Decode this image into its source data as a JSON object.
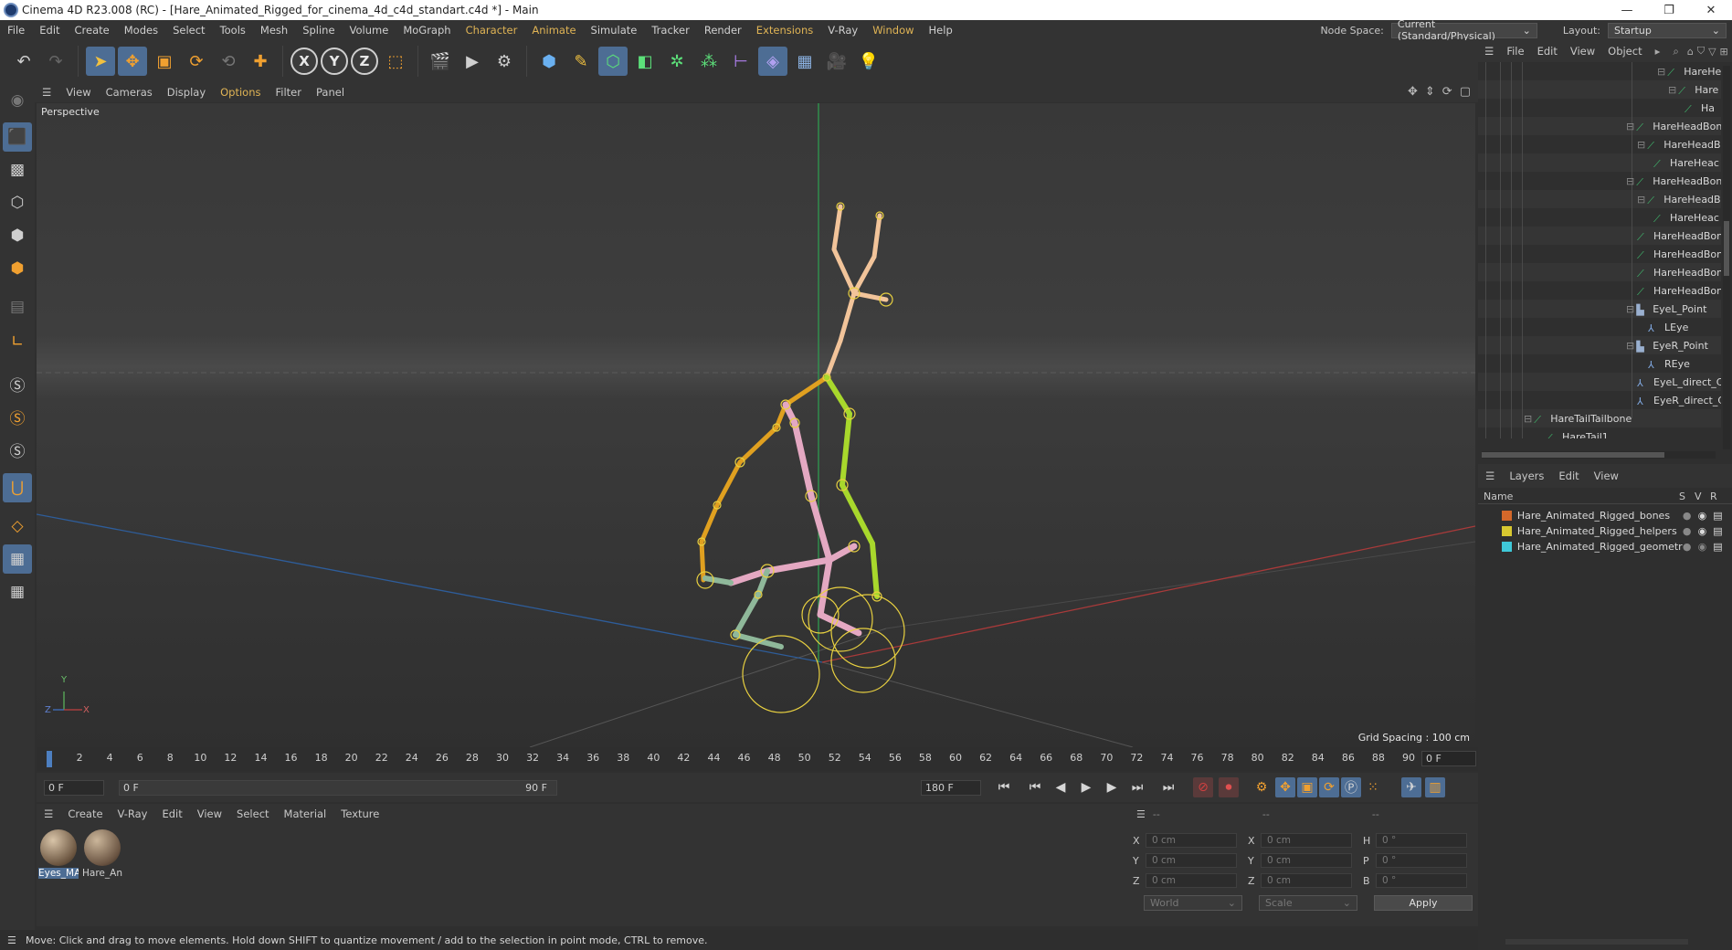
{
  "window": {
    "title": "Cinema 4D R23.008 (RC) - [Hare_Animated_Rigged_for_cinema_4d_c4d_standart.c4d *] - Main",
    "controls": [
      "—",
      "❐",
      "✕"
    ]
  },
  "menubar": {
    "items": [
      "File",
      "Edit",
      "Create",
      "Modes",
      "Select",
      "Tools",
      "Mesh",
      "Spline",
      "Volume",
      "MoGraph",
      "Character",
      "Animate",
      "Simulate",
      "Tracker",
      "Render",
      "Extensions",
      "V-Ray",
      "Window",
      "Help"
    ],
    "node_space_label": "Node Space:",
    "node_space_value": "Current (Standard/Physical)",
    "layout_label": "Layout:",
    "layout_value": "Startup"
  },
  "toolbar": {
    "x_label": "X",
    "y_label": "Y",
    "z_label": "Z"
  },
  "viewport": {
    "menu": [
      "View",
      "Cameras",
      "Display",
      "Options",
      "Filter",
      "Panel"
    ],
    "label": "Perspective",
    "grid_spacing": "Grid Spacing : 100 cm",
    "axis_y": "Y",
    "axis_x": "X",
    "axis_z": "Z"
  },
  "timeline": {
    "ticks": [
      "0",
      "2",
      "4",
      "6",
      "8",
      "10",
      "12",
      "14",
      "16",
      "18",
      "20",
      "22",
      "24",
      "26",
      "28",
      "30",
      "32",
      "34",
      "36",
      "38",
      "40",
      "42",
      "44",
      "46",
      "48",
      "50",
      "52",
      "54",
      "56",
      "58",
      "60",
      "62",
      "64",
      "66",
      "68",
      "70",
      "72",
      "74",
      "76",
      "78",
      "80",
      "82",
      "84",
      "86",
      "88",
      "90"
    ],
    "current_frame": "0 F"
  },
  "playbar": {
    "start": "0 F",
    "range_start": "0 F",
    "range_end": "90 F",
    "end": "180 F"
  },
  "materials": {
    "menu": [
      "Create",
      "V-Ray",
      "Edit",
      "View",
      "Select",
      "Material",
      "Texture"
    ],
    "items": [
      {
        "name": "Eyes_MA"
      },
      {
        "name": "Hare_An"
      }
    ]
  },
  "attributes": {
    "header": [
      "--",
      "--",
      "--"
    ],
    "rows": [
      {
        "l1": "X",
        "v1": "0 cm",
        "l2": "X",
        "v2": "0 cm",
        "l3": "H",
        "v3": "0 °"
      },
      {
        "l1": "Y",
        "v1": "0 cm",
        "l2": "Y",
        "v2": "0 cm",
        "l3": "P",
        "v3": "0 °"
      },
      {
        "l1": "Z",
        "v1": "0 cm",
        "l2": "Z",
        "v2": "0 cm",
        "l3": "B",
        "v3": "0 °"
      }
    ],
    "coord_mode": "World",
    "size_mode": "Scale",
    "apply_label": "Apply"
  },
  "status": {
    "text": "Move: Click and drag to move elements. Hold down SHIFT to quantize movement / add to the selection in point mode, CTRL to remove."
  },
  "objects": {
    "menu": [
      "File",
      "Edit",
      "View",
      "Object"
    ],
    "items": [
      {
        "name": "HareHe"
      },
      {
        "name": "Hare"
      },
      {
        "name": "Ha"
      },
      {
        "name": "HareHeadBon"
      },
      {
        "name": "HareHeadBo"
      },
      {
        "name": "HareHeac"
      },
      {
        "name": "HareHeadBon"
      },
      {
        "name": "HareHeadBo"
      },
      {
        "name": "HareHeac"
      },
      {
        "name": "HareHeadBon"
      },
      {
        "name": "HareHeadBon"
      },
      {
        "name": "HareHeadBon"
      },
      {
        "name": "HareHeadBon"
      },
      {
        "name": "EyeL_Point"
      },
      {
        "name": "LEye"
      },
      {
        "name": "EyeR_Point"
      },
      {
        "name": "REye"
      },
      {
        "name": "EyeL_direct_Cl"
      },
      {
        "name": "EyeR_direct_Cl"
      },
      {
        "name": "HareTailTailbone"
      },
      {
        "name": "HareTail1"
      }
    ]
  },
  "layers": {
    "menu": [
      "Layers",
      "Edit",
      "View"
    ],
    "col_name": "Name",
    "col_s": "S",
    "col_v": "V",
    "col_r": "R",
    "items": [
      {
        "name": "Hare_Animated_Rigged_bones",
        "color": "#d4682a"
      },
      {
        "name": "Hare_Animated_Rigged_helpers",
        "color": "#d8c830"
      },
      {
        "name": "Hare_Animated_Rigged_geometru",
        "color": "#3fc8d8"
      }
    ]
  }
}
